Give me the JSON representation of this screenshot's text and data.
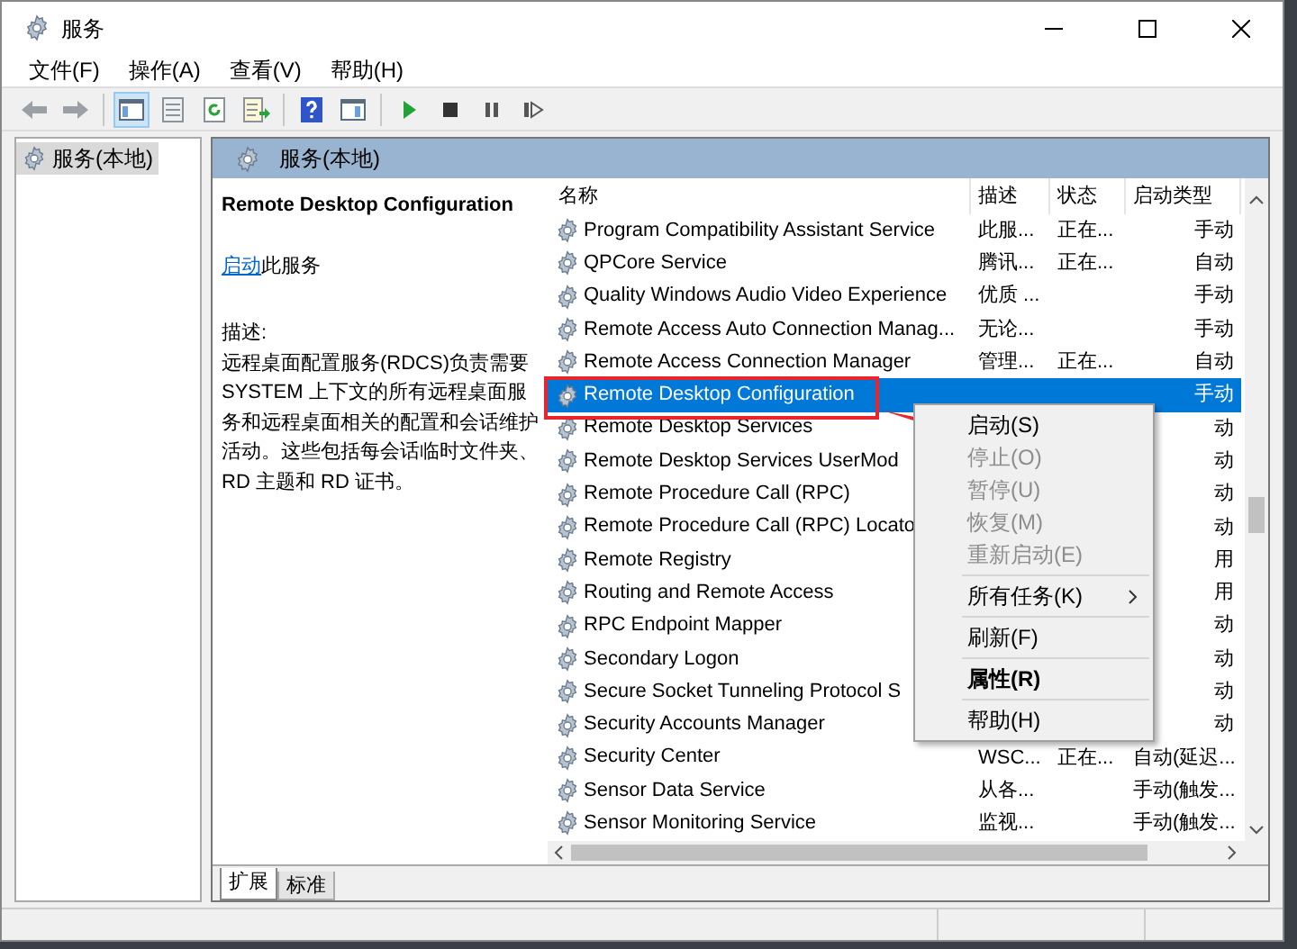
{
  "window": {
    "title": "服务"
  },
  "menu": [
    "文件(F)",
    "操作(A)",
    "查看(V)",
    "帮助(H)"
  ],
  "toolbar": [
    {
      "kind": "back",
      "selected": false
    },
    {
      "kind": "forward",
      "selected": false
    },
    {
      "kind": "sep"
    },
    {
      "kind": "tree",
      "selected": true
    },
    {
      "kind": "list",
      "selected": false
    },
    {
      "kind": "refresh",
      "selected": false
    },
    {
      "kind": "export",
      "selected": false
    },
    {
      "kind": "sep"
    },
    {
      "kind": "help",
      "selected": false
    },
    {
      "kind": "console",
      "selected": false
    },
    {
      "kind": "sep"
    },
    {
      "kind": "play",
      "selected": false
    },
    {
      "kind": "stop",
      "selected": false
    },
    {
      "kind": "pause",
      "selected": false
    },
    {
      "kind": "restart",
      "selected": false
    }
  ],
  "tree": [
    {
      "label": "服务(本地)",
      "selected": true
    }
  ],
  "pane_header": "服务(本地)",
  "detail": {
    "title": "Remote Desktop Configuration",
    "action_link": "启动",
    "action_text": "此服务",
    "desc_label": "描述:",
    "description": "远程桌面配置服务(RDCS)负责需要 SYSTEM 上下文的所有远程桌面服务和远程桌面相关的配置和会话维护活动。这些包括每会话临时文件夹、RD 主题和 RD 证书。"
  },
  "table": {
    "columns": [
      "名称",
      "描述",
      "状态",
      "启动类型"
    ],
    "rows": [
      {
        "name": "Program Compatibility Assistant Service",
        "desc": "此服...",
        "status": "正在...",
        "startup": "手动",
        "selected": false
      },
      {
        "name": "QPCore Service",
        "desc": "腾讯...",
        "status": "正在...",
        "startup": "自动",
        "selected": false
      },
      {
        "name": "Quality Windows Audio Video Experience",
        "desc": "优质 ...",
        "startup": "手动",
        "selected": false
      },
      {
        "name": "Remote Access Auto Connection Manag...",
        "desc": "无论...",
        "startup": "手动",
        "selected": false
      },
      {
        "name": "Remote Access Connection Manager",
        "desc": "管理...",
        "status": "正在...",
        "startup": "自动",
        "selected": false
      },
      {
        "name": "Remote Desktop Configuration",
        "startup": "手动",
        "selected": true
      },
      {
        "name": "Remote Desktop Services",
        "startup": "动",
        "selected": false
      },
      {
        "name": "Remote Desktop Services UserMod",
        "startup": "动",
        "selected": false
      },
      {
        "name": "Remote Procedure Call (RPC)",
        "startup": "动",
        "selected": false
      },
      {
        "name": "Remote Procedure Call (RPC) Locato",
        "startup": "动",
        "selected": false
      },
      {
        "name": "Remote Registry",
        "startup": "用",
        "selected": false
      },
      {
        "name": "Routing and Remote Access",
        "startup": "用",
        "selected": false
      },
      {
        "name": "RPC Endpoint Mapper",
        "startup": "动",
        "selected": false
      },
      {
        "name": "Secondary Logon",
        "startup": "动",
        "selected": false
      },
      {
        "name": "Secure Socket Tunneling Protocol S",
        "startup": "动",
        "selected": false
      },
      {
        "name": "Security Accounts Manager",
        "startup": "动",
        "selected": false
      },
      {
        "name": "Security Center",
        "desc": "WSC...",
        "status": "正在...",
        "startup": "自动(延迟...",
        "selected": false
      },
      {
        "name": "Sensor Data Service",
        "desc": "从各...",
        "startup": "手动(触发...",
        "selected": false
      },
      {
        "name": "Sensor Monitoring Service",
        "desc": "监视...",
        "startup": "手动(触发...",
        "selected": false
      }
    ]
  },
  "context_menu": [
    {
      "kind": "item",
      "label": "启动(S)",
      "disabled": false
    },
    {
      "kind": "item",
      "label": "停止(O)",
      "disabled": true
    },
    {
      "kind": "item",
      "label": "暂停(U)",
      "disabled": true
    },
    {
      "kind": "item",
      "label": "恢复(M)",
      "disabled": true
    },
    {
      "kind": "item",
      "label": "重新启动(E)",
      "disabled": true
    },
    {
      "kind": "separator"
    },
    {
      "kind": "submenu",
      "label": "所有任务(K)",
      "disabled": false
    },
    {
      "kind": "separator"
    },
    {
      "kind": "item",
      "label": "刷新(F)",
      "disabled": false
    },
    {
      "kind": "separator"
    },
    {
      "kind": "bold",
      "label": "属性(R)",
      "disabled": false
    },
    {
      "kind": "separator"
    },
    {
      "kind": "item",
      "label": "帮助(H)",
      "disabled": false
    }
  ],
  "bottom_tabs": [
    {
      "label": "扩展",
      "selected": true
    },
    {
      "label": "标准",
      "selected": false
    }
  ]
}
